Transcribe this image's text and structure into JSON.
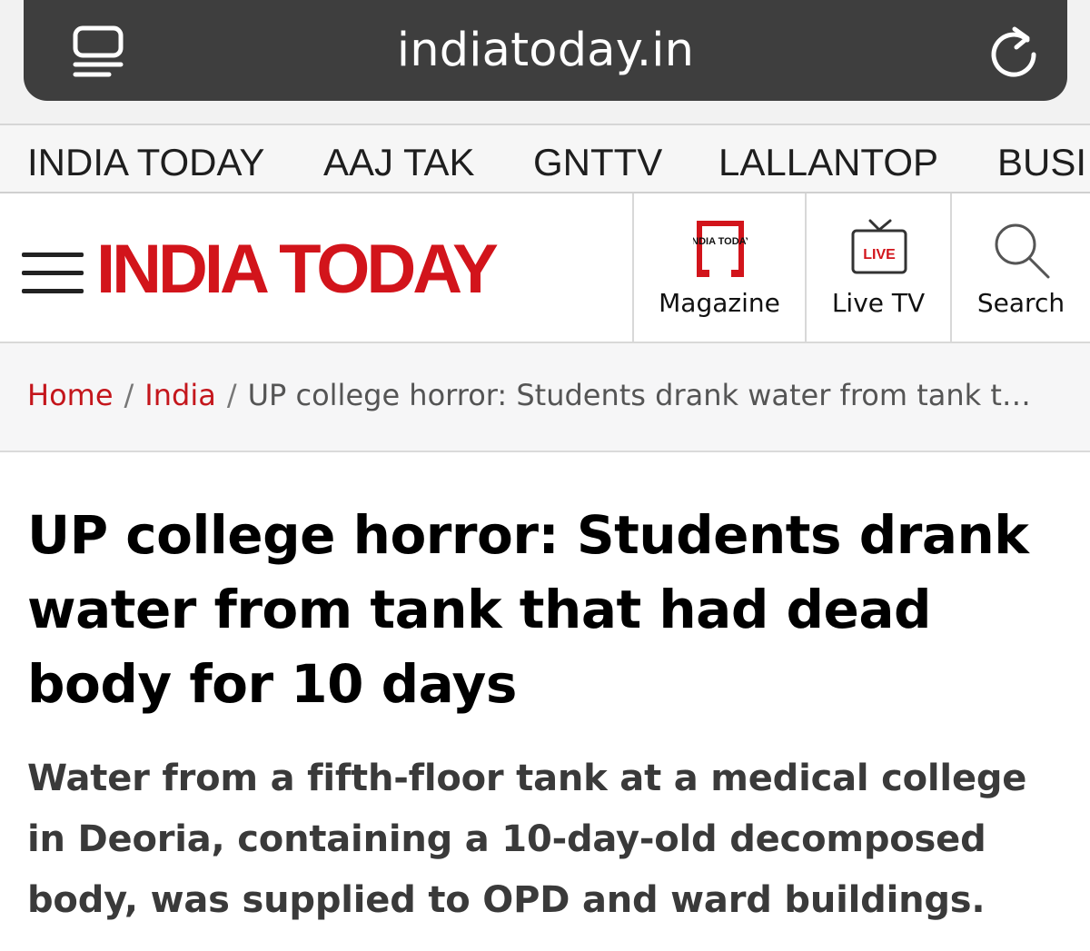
{
  "browser": {
    "url": "indiatoday.in"
  },
  "network_nav": {
    "items": [
      "INDIA TODAY",
      "AAJ TAK",
      "GNTTV",
      "LALLANTOP",
      "BUSI"
    ]
  },
  "header": {
    "logo": "INDIA TODAY",
    "magazine_icon_text": "INDIA TODAY",
    "magazine_label": "Magazine",
    "live_badge": "LIVE",
    "live_tv_label": "Live TV",
    "search_label": "Search"
  },
  "breadcrumb": {
    "home": "Home",
    "section": "India",
    "current": "UP college horror: Students drank water from tank tha..."
  },
  "article": {
    "headline": "UP college horror: Students drank water from tank that had dead body for 10 days",
    "summary": "Water from a fifth-floor tank at a medical college in Deoria, containing a 10-day-old decomposed body, was supplied to OPD and ward buildings."
  },
  "colors": {
    "brand_red": "#d2141b",
    "urlbar_bg": "#3e3e3e"
  }
}
